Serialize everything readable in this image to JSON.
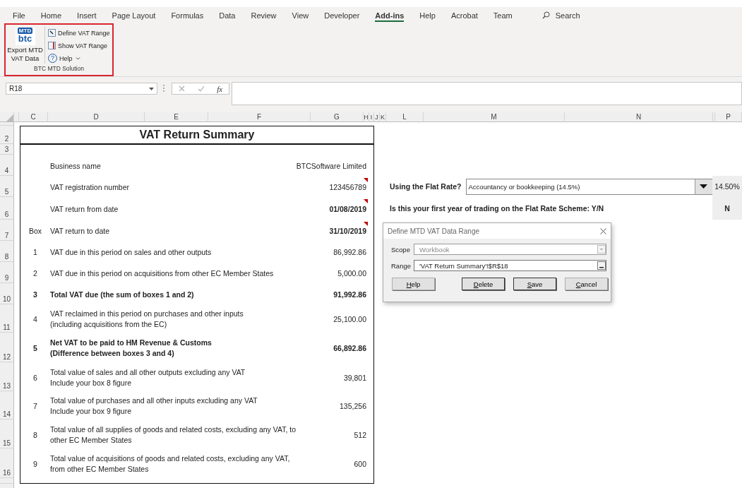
{
  "menu_tabs": [
    {
      "label": "File",
      "selected": false
    },
    {
      "label": "Home",
      "selected": false
    },
    {
      "label": "Insert",
      "selected": false
    },
    {
      "label": "Page Layout",
      "selected": false
    },
    {
      "label": "Formulas",
      "selected": false
    },
    {
      "label": "Data",
      "selected": false
    },
    {
      "label": "Review",
      "selected": false
    },
    {
      "label": "View",
      "selected": false
    },
    {
      "label": "Developer",
      "selected": false
    },
    {
      "label": "Add-ins",
      "selected": true
    },
    {
      "label": "Help",
      "selected": false
    },
    {
      "label": "Acrobat",
      "selected": false
    },
    {
      "label": "Team",
      "selected": false
    }
  ],
  "search": {
    "placeholder": "Search"
  },
  "ribbon": {
    "group_label": "BTC MTD Solution",
    "logo": {
      "badge": "MTD",
      "wordmark": "btc"
    },
    "large_button": "Export MTD VAT Data",
    "small_buttons": [
      {
        "label": "Define VAT Range",
        "kind": "define",
        "has_menu": false
      },
      {
        "label": "Show VAT Range",
        "kind": "show",
        "has_menu": false
      },
      {
        "label": "Help",
        "kind": "help",
        "glyph": "?",
        "has_menu": true
      }
    ]
  },
  "formula_bar": {
    "name_box": "R18",
    "function_label": "fx"
  },
  "columns": [
    "C",
    "D",
    "E",
    "F",
    "G",
    "H",
    "I",
    "J",
    "K",
    "L",
    "M",
    "N",
    "P"
  ],
  "row_numbers": [
    "2",
    "3",
    "4",
    "5",
    "6",
    "7",
    "8",
    "9",
    "10",
    "11",
    "12",
    "13",
    "14",
    "15",
    "16"
  ],
  "summary": {
    "title": "VAT Return Summary",
    "box_heading": "Box",
    "details": [
      {
        "label": "Business name",
        "value": "BTCSoftware Limited",
        "bold": false,
        "has_comment": false
      },
      {
        "label": "VAT registration number",
        "value": "123456789",
        "bold": false,
        "has_comment": true
      },
      {
        "label": "VAT return from date",
        "value": "01/08/2019",
        "bold": true,
        "has_comment": true
      },
      {
        "label": "VAT return to date",
        "value": "31/10/2019",
        "bold": true,
        "has_comment": true
      }
    ],
    "boxes": [
      {
        "number": "1",
        "lines": [
          "VAT due in this period on sales and other outputs"
        ],
        "value": "86,992.86",
        "bold": false
      },
      {
        "number": "2",
        "lines": [
          "VAT due in this period on acquisitions from other EC Member States"
        ],
        "value": "5,000.00",
        "bold": false
      },
      {
        "number": "3",
        "lines": [
          "Total VAT due (the sum of boxes 1 and 2)"
        ],
        "value": "91,992.86",
        "bold": true
      },
      {
        "number": "4",
        "lines": [
          "VAT reclaimed in this period on purchases and other inputs",
          "(including acquisitions from the EC)"
        ],
        "value": "25,100.00",
        "bold": false
      },
      {
        "number": "5",
        "lines": [
          "Net VAT to be paid to HM Revenue & Customs",
          "(Difference between boxes 3 and 4)"
        ],
        "value": "66,892.86",
        "bold": true
      },
      {
        "number": "6",
        "lines": [
          "Total value of sales and all other outputs excluding any VAT",
          "Include your box 8 figure"
        ],
        "value": "39,801",
        "bold": false
      },
      {
        "number": "7",
        "lines": [
          "Total value of purchases and all other inputs excluding any VAT",
          "Include your box 9 figure"
        ],
        "value": "135,256",
        "bold": false
      },
      {
        "number": "8",
        "lines": [
          "Total value of all supplies of goods and related costs, excluding any VAT, to",
          "other EC Member States"
        ],
        "value": "512",
        "bold": false
      },
      {
        "number": "9",
        "lines": [
          "Total value of acquisitions of goods and related costs, excluding any VAT,",
          "from other EC Member States"
        ],
        "value": "600",
        "bold": false
      }
    ]
  },
  "flat_rate": {
    "label": "Using the Flat Rate?",
    "selection": "Accountancy or bookkeeping (14.5%)",
    "rate": "14.50%",
    "first_year_label": "Is this your first year of trading on the Flat Rate Scheme: Y/N",
    "first_year_value": "N"
  },
  "dialog": {
    "title": "Define MTD VAT Data Range",
    "fields": [
      {
        "label": "Scope",
        "value": "Workbook",
        "disabled": true,
        "kind": "dropdown"
      },
      {
        "label": "Range",
        "value": "'VAT Return Summary'!$R$18",
        "disabled": false,
        "kind": "reference"
      }
    ],
    "buttons": [
      {
        "label": "Help",
        "mnemonic": true,
        "emphasized": false
      },
      {
        "label": "Delete",
        "mnemonic": true,
        "emphasized": true
      },
      {
        "label": "Save",
        "mnemonic": true,
        "emphasized": true
      },
      {
        "label": "Cancel",
        "mnemonic": true,
        "emphasized": false
      }
    ]
  }
}
